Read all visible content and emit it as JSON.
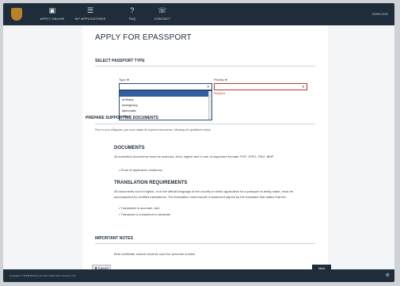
{
  "topbar": {
    "nav": [
      {
        "label": "APPLY ONLINE",
        "icon": "passport-icon"
      },
      {
        "label": "MY APPLICATIONS",
        "icon": "list-icon"
      },
      {
        "label": "FAQ",
        "icon": "question-icon"
      },
      {
        "label": "CONTACT",
        "icon": "phone-icon"
      }
    ],
    "user_name": "JOHN DOE"
  },
  "page": {
    "title": "APPLY FOR EPASSPORT",
    "select_type_heading": "SELECT PASSPORT TYPE",
    "type_label": "Type ★",
    "priority_label": "Priority ★",
    "type_options": [
      "",
      "ordinary",
      "emergency",
      "diplomatic",
      "official"
    ],
    "required_msg": "Required",
    "prepare_heading": "PREPARE SUPPORTING DOCUMENTS",
    "prepare_intro": "Prior to your eMigrator, you must obtain all required documents, following the guidelines below",
    "documents_heading": "DOCUMENTS",
    "documents_text": "All submitted documents must be scanned, clear, legible and in one of supported formats: PDF, JPEG, PNG, BMP",
    "documents_bullets": [
      "Proof of applicant's residence"
    ],
    "translation_heading": "TRANSLATION REQUIREMENTS",
    "translation_text": "All documents not in English, or in the official language of the country in which application for a passport is being made, must be accompanied by certified translations. The translation must include a statement signed by the translator that states that the:",
    "translation_bullets": [
      "Translation is accurate, and",
      "Translator is competent to translate"
    ],
    "notes_heading": "IMPORTANT NOTES",
    "notes_text": "Birth certificate number shall be used for personal number",
    "cancel_label": "Cancel",
    "next_label": "Next"
  },
  "footer": {
    "copyright": "Copyright © SPPM Ministry of Interior Web Client Version 1.0.0"
  }
}
